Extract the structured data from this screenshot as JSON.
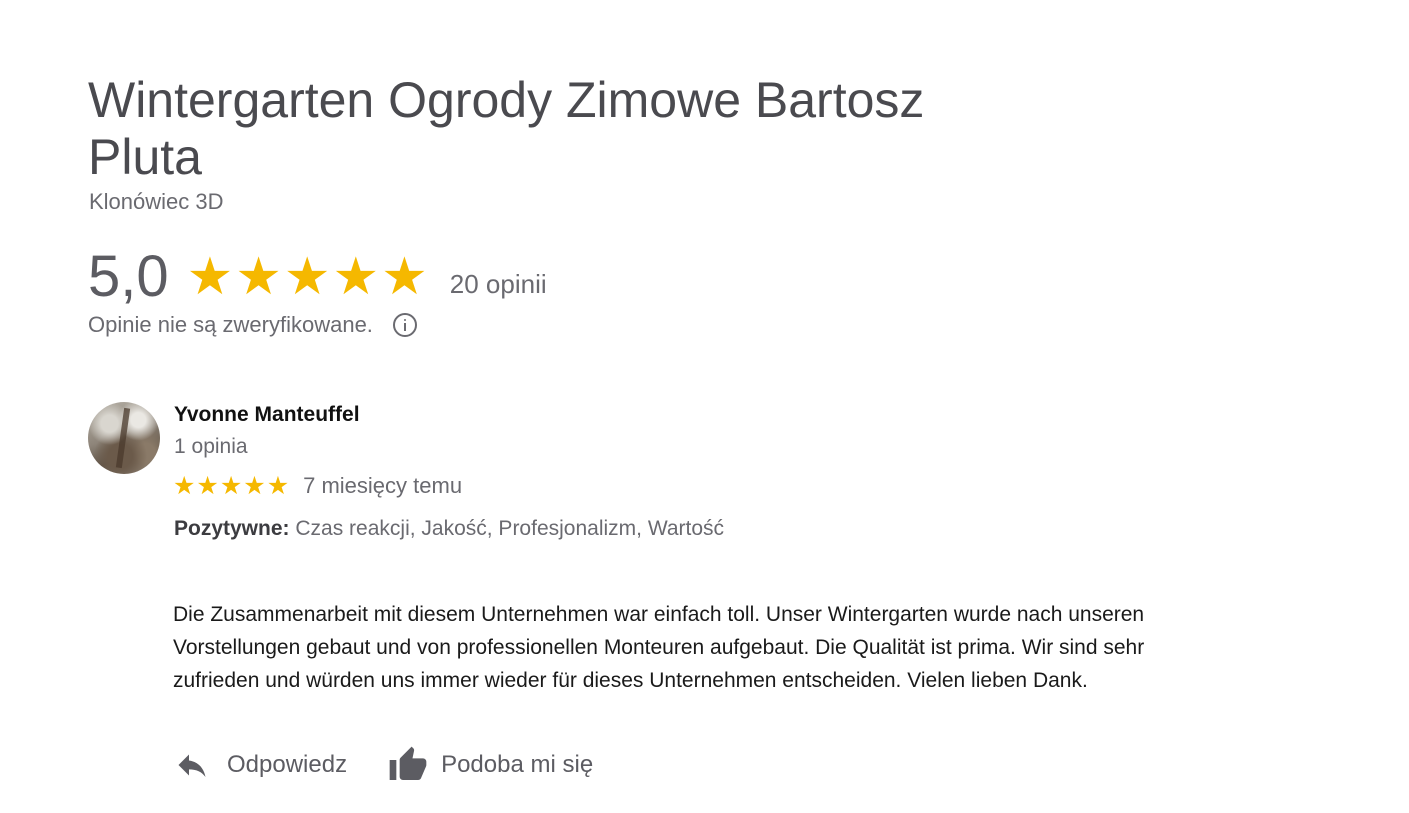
{
  "business": {
    "name": "Wintergarten Ogrody Zimowe Bartosz Pluta",
    "location": "Klonówiec 3D"
  },
  "summary": {
    "rating": "5,0",
    "stars": 5,
    "review_count": "20 opinii",
    "unverified_note": "Opinie nie są zweryfikowane.",
    "info_icon": "info-icon"
  },
  "review": {
    "author": "Yvonne Manteuffel",
    "author_reviews": "1 opinia",
    "stars": 5,
    "time": "7 miesięcy temu",
    "positives_label": "Pozytywne:",
    "positives_value": "Czas reakcji, Jakość, Profesjonalizm, Wartość",
    "text": "Die Zusammenarbeit mit diesem Unternehmen war einfach toll. Unser Wintergarten wurde nach unseren Vorstellungen gebaut und von professionellen Monteuren aufgebaut. Die Qualität ist prima. Wir sind sehr zufrieden und würden uns immer wieder für dieses Unternehmen entscheiden. Vielen lieben Dank."
  },
  "actions": {
    "reply_label": "Odpowiedz",
    "like_label": "Podoba mi się"
  },
  "colors": {
    "star": "#f5b800",
    "text_muted": "#6a6a70",
    "title": "#4a4a4f"
  }
}
